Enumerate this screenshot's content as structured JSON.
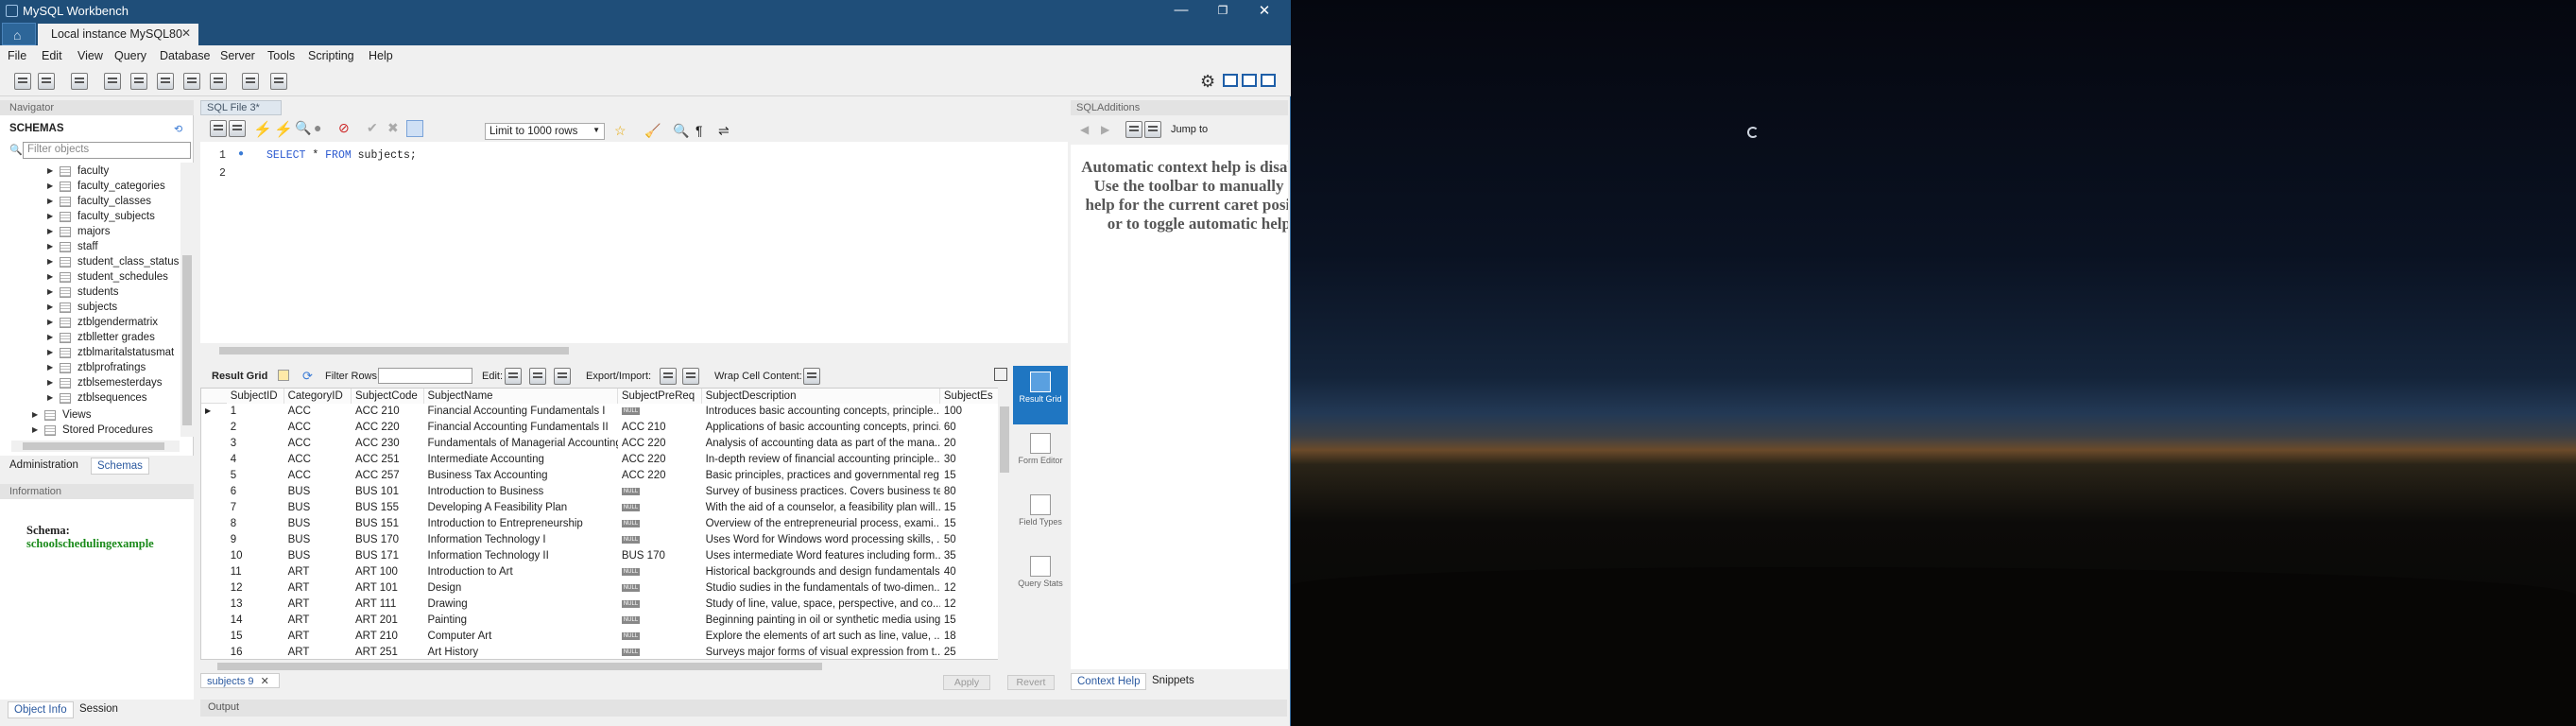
{
  "window": {
    "title": "MySQL Workbench",
    "connection_tab": "Local instance MySQL80"
  },
  "menu": [
    "File",
    "Edit",
    "View",
    "Query",
    "Database",
    "Server",
    "Tools",
    "Scripting",
    "Help"
  ],
  "navigator": {
    "header": "Navigator",
    "schemas_label": "SCHEMAS",
    "filter_placeholder": "Filter objects",
    "tables": [
      "faculty",
      "faculty_categories",
      "faculty_classes",
      "faculty_subjects",
      "majors",
      "staff",
      "student_class_status",
      "student_schedules",
      "students",
      "subjects",
      "ztblgendermatrix",
      "ztblletter grades",
      "ztblmaritalstatusmat",
      "ztblprofratings",
      "ztblsemesterdays",
      "ztblsequences"
    ],
    "folders": [
      "Views",
      "Stored Procedures"
    ],
    "tabs": [
      "Administration",
      "Schemas"
    ],
    "info_header": "Information",
    "schema_label": "Schema:",
    "schema_name": "schoolschedulingexample",
    "bottom_tabs": [
      "Object Info",
      "Session"
    ]
  },
  "editor": {
    "tab": "SQL File 3*",
    "limit": "Limit to 1000 rows",
    "lines": [
      "1",
      "2"
    ],
    "code_kw1": "SELECT",
    "code_star": " * ",
    "code_kw2": "FROM",
    "code_rest": " subjects;"
  },
  "result": {
    "grid_label": "Result Grid",
    "filter_label": "Filter Rows:",
    "edit_label": "Edit:",
    "export_label": "Export/Import:",
    "wrap_label": "Wrap Cell Content:",
    "columns": [
      "SubjectID",
      "CategoryID",
      "SubjectCode",
      "SubjectName",
      "SubjectPreReq",
      "SubjectDescription",
      "SubjectEs"
    ],
    "rows": [
      [
        "1",
        "ACC",
        "ACC 210",
        "Financial Accounting Fundamentals I",
        "NULL",
        "Introduces basic accounting concepts, principle...",
        "100"
      ],
      [
        "2",
        "ACC",
        "ACC 220",
        "Financial Accounting Fundamentals II",
        "ACC 210",
        "Applications of basic accounting concepts, princi...",
        "60"
      ],
      [
        "3",
        "ACC",
        "ACC 230",
        "Fundamentals of Managerial Accounting",
        "ACC 220",
        "Analysis of accounting data as part of the mana...",
        "20"
      ],
      [
        "4",
        "ACC",
        "ACC 251",
        "Intermediate Accounting",
        "ACC 220",
        "In-depth review of financial accounting principle...",
        "30"
      ],
      [
        "5",
        "ACC",
        "ACC 257",
        "Business Tax Accounting",
        "ACC 220",
        "Basic principles, practices and governmental reg...",
        "15"
      ],
      [
        "6",
        "BUS",
        "BUS 101",
        "Introduction to Business",
        "NULL",
        "Survey of business practices. Covers business te...",
        "80"
      ],
      [
        "7",
        "BUS",
        "BUS 155",
        "Developing A Feasibility Plan",
        "NULL",
        "With the aid of a counselor, a feasibility plan will...",
        "15"
      ],
      [
        "8",
        "BUS",
        "BUS 151",
        "Introduction to Entrepreneurship",
        "NULL",
        "Overview of the entrepreneurial process, exami...",
        "15"
      ],
      [
        "9",
        "BUS",
        "BUS 170",
        "Information Technology I",
        "NULL",
        "Uses Word for Windows word processing skills, ...",
        "50"
      ],
      [
        "10",
        "BUS",
        "BUS 171",
        "Information Technology II",
        "BUS 170",
        "Uses intermediate Word features including form...",
        "35"
      ],
      [
        "11",
        "ART",
        "ART 100",
        "Introduction to Art",
        "NULL",
        "Historical backgrounds and design fundamentals...",
        "40"
      ],
      [
        "12",
        "ART",
        "ART 101",
        "Design",
        "NULL",
        "Studio sudies in the fundamentals of two-dimen...",
        "12"
      ],
      [
        "13",
        "ART",
        "ART 111",
        "Drawing",
        "NULL",
        "Study of line, value, space, perspective, and co...",
        "12"
      ],
      [
        "14",
        "ART",
        "ART 201",
        "Painting",
        "NULL",
        "Beginning painting in oil or synthetic media using...",
        "15"
      ],
      [
        "15",
        "ART",
        "ART 210",
        "Computer Art",
        "NULL",
        "Explore the elements of art such as line, value, ...",
        "18"
      ],
      [
        "16",
        "ART",
        "ART 251",
        "Art History",
        "NULL",
        "Surveys major forms of visual expression from t...",
        "25"
      ]
    ],
    "side": [
      "Result Grid",
      "Form Editor",
      "Field Types",
      "Query Stats"
    ],
    "result_tab": "subjects 9",
    "apply": "Apply",
    "revert": "Revert"
  },
  "additions": {
    "header": "SQLAdditions",
    "jump": "Jump to",
    "help": "Automatic context help is disabled. Use the toolbar to manually get help for the current caret position or to toggle automatic help.",
    "tabs": [
      "Context Help",
      "Snippets"
    ]
  },
  "output": "Output"
}
